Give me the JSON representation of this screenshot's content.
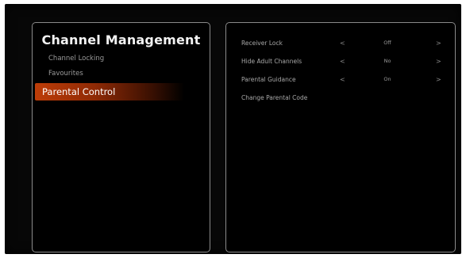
{
  "left_panel": {
    "title": "Channel Management",
    "items": [
      {
        "label": "Channel Locking",
        "selected": false
      },
      {
        "label": "Favourites",
        "selected": false
      },
      {
        "label": "Parental Control",
        "selected": true
      }
    ]
  },
  "right_panel": {
    "settings": [
      {
        "label": "Receiver Lock",
        "value": "Off",
        "left_arrow": "<",
        "right_arrow": ">"
      },
      {
        "label": "Hide Adult Channels",
        "value": "No",
        "left_arrow": "<",
        "right_arrow": ">"
      },
      {
        "label": "Parental Guidance",
        "value": "On",
        "left_arrow": "<",
        "right_arrow": ">"
      },
      {
        "label": "Change Parental Code"
      }
    ]
  },
  "colors": {
    "selection_accent": "#bd3d08",
    "panel_border": "#8a8a8a",
    "background": "#000000"
  }
}
